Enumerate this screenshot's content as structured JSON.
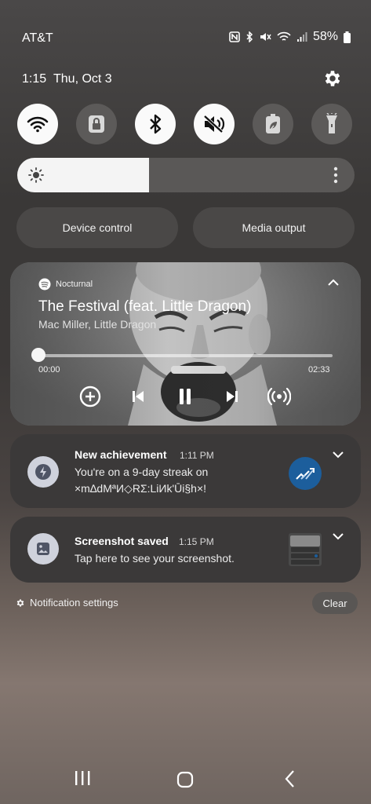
{
  "status": {
    "carrier": "AT&T",
    "battery": "58%"
  },
  "header": {
    "time": "1:15",
    "date": "Thu, Oct 3"
  },
  "quick_toggles": [
    {
      "name": "wifi",
      "icon": "wifi-icon",
      "on": true
    },
    {
      "name": "lock-rotation",
      "icon": "lock-icon",
      "on": false
    },
    {
      "name": "bluetooth",
      "icon": "bluetooth-icon",
      "on": true
    },
    {
      "name": "mute",
      "icon": "mute-icon",
      "on": true
    },
    {
      "name": "power-saving",
      "icon": "leaf-battery-icon",
      "on": false
    },
    {
      "name": "flashlight",
      "icon": "flashlight-icon",
      "on": false
    }
  ],
  "brightness": {
    "level": 0.39
  },
  "pills": {
    "device_control": "Device control",
    "media_output": "Media output"
  },
  "media": {
    "app": "Nocturnal",
    "title": "The Festival (feat. Little Dragon)",
    "artist": "Mac Miller, Little Dragon",
    "position": "00:00",
    "duration": "02:33",
    "progress": 0.0
  },
  "notifications": [
    {
      "title": "New achievement",
      "time": "1:11 PM",
      "body1": "You're on a 9-day streak on",
      "body2": "×m∆dMªИ◇RΣ:LiИk'Ūi§h×!",
      "icon": "bolt-icon"
    },
    {
      "title": "Screenshot saved",
      "time": "1:15 PM",
      "body1": "Tap here to see your screenshot.",
      "icon": "image-icon"
    }
  ],
  "footer": {
    "notification_settings": "Notification settings",
    "clear": "Clear"
  },
  "colors": {
    "accent_blue": "#1c5e9c",
    "toggle_on": "#fafafa",
    "toggle_off": "#5c5a59"
  }
}
